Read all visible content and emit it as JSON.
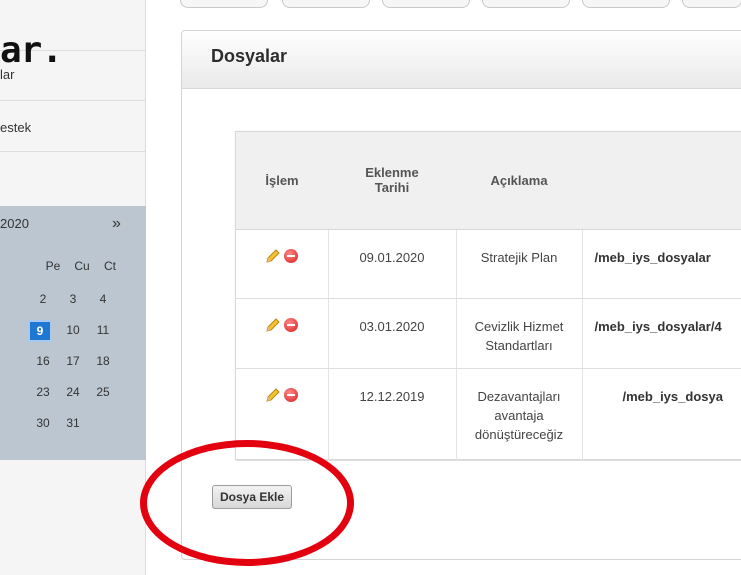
{
  "overlay": {
    "text": "ar."
  },
  "sidebar": {
    "items": [
      {
        "label": "lar"
      },
      {
        "label": "estek"
      }
    ]
  },
  "calendar": {
    "year_label": "2020",
    "next_label": "»",
    "weekdays": [
      "Pe",
      "Cu",
      "Ct"
    ],
    "rows": [
      [
        "2",
        "3",
        "4"
      ],
      [
        "9",
        "10",
        "11"
      ],
      [
        "16",
        "17",
        "18"
      ],
      [
        "23",
        "24",
        "25"
      ],
      [
        "30",
        "31",
        ""
      ]
    ],
    "selected": "9"
  },
  "panel": {
    "title": "Dosyalar",
    "table": {
      "headers": {
        "op": "İşlem",
        "date": "Eklenme Tarihi",
        "desc": "Açıklama"
      },
      "rows": [
        {
          "date": "09.01.2020",
          "desc": "Stratejik Plan",
          "path": "/meb_iys_dosyalar"
        },
        {
          "date": "03.01.2020",
          "desc": "Cevizlik Hizmet Standartları",
          "path": "/meb_iys_dosyalar/4"
        },
        {
          "date": "12.12.2019",
          "desc": "Dezavantajları avantaja dönüştüreceğiz",
          "path": "/meb_iys_dosya"
        }
      ]
    },
    "add_button": "Dosya Ekle"
  },
  "colors": {
    "annotation_circle": "#e3000f",
    "calendar_bg": "#bcc6d0",
    "selected_day": "#1e78d2",
    "delete_icon": "#d81b1b"
  }
}
